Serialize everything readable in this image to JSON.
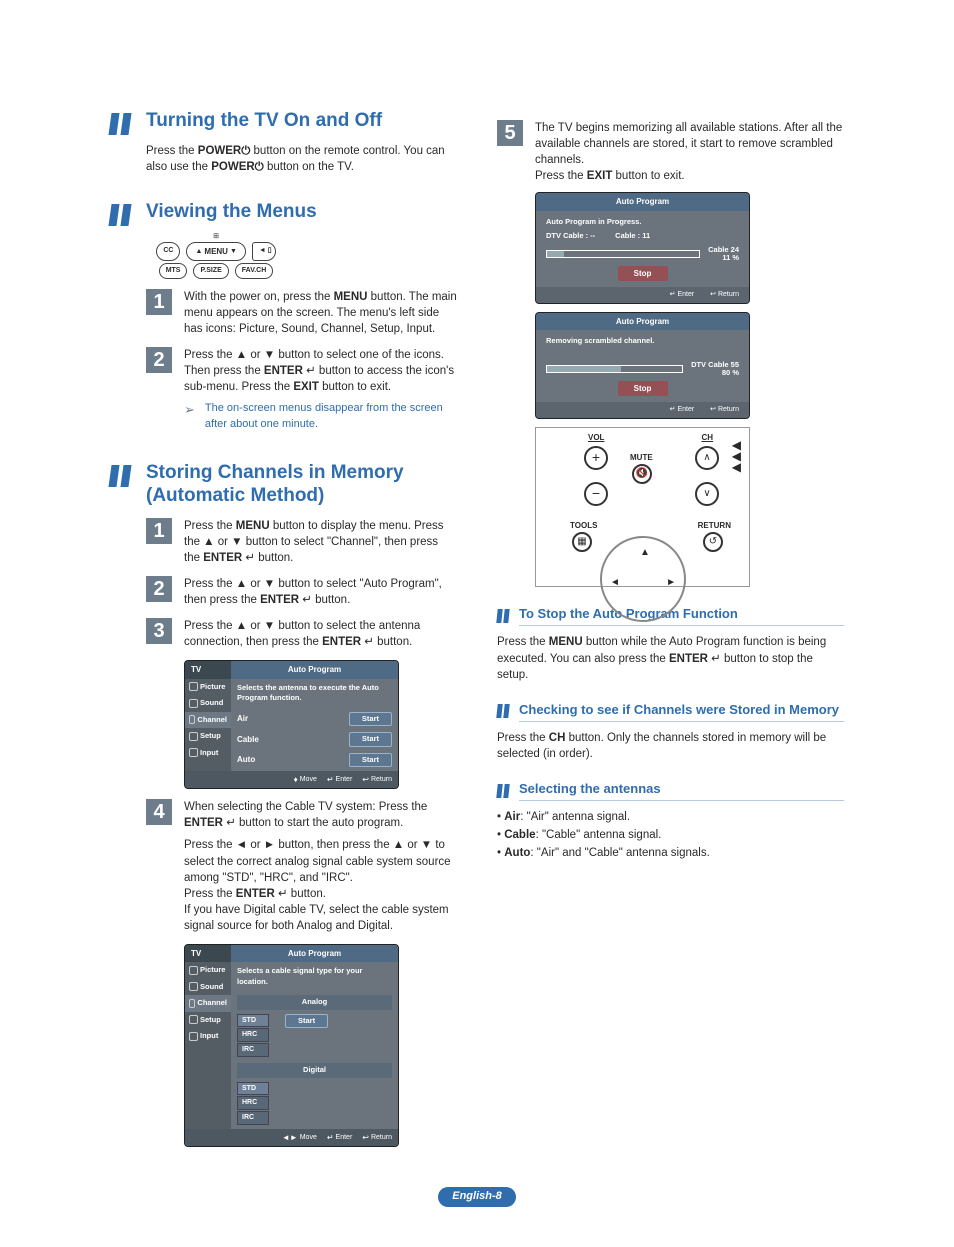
{
  "left": {
    "sec1": {
      "title": "Turning the TV On and Off",
      "p1_a": "Press the ",
      "p1_power": "POWER",
      "p1_b": " button on the remote control. You can also use the ",
      "p1_c": " button on the TV."
    },
    "sec2": {
      "title": "Viewing the Menus",
      "nav": {
        "cc": "CC",
        "menu": "MENU",
        "mts": "MTS",
        "psize": "P.SIZE",
        "favch": "FAV.CH"
      },
      "step1": {
        "num": "1",
        "a": "With the power on, press the ",
        "menu": "MENU",
        "b": " button. The main menu appears on the screen. The menu's left side has icons: Picture, Sound, Channel, Setup, Input."
      },
      "step2": {
        "num": "2",
        "a": "Press the ▲ or ▼ button to select one of the icons. Then press the ",
        "enter": "ENTER",
        "b": " button to access the icon's sub-menu. Press the ",
        "exit": "EXIT",
        "c": " button to exit."
      },
      "note": "The on-screen menus disappear from the screen after about one minute."
    },
    "sec3": {
      "title": "Storing Channels in Memory (Automatic Method)",
      "step1": {
        "num": "1",
        "a": "Press the ",
        "menu": "MENU",
        "b": " button to display the menu. Press the ▲ or ▼ button to select \"Channel\", then press the ",
        "enter": "ENTER",
        "c": " button."
      },
      "step2": {
        "num": "2",
        "a": "Press the ▲ or ▼ button to select \"Auto Program\", then press the ",
        "enter": "ENTER",
        "b": " button."
      },
      "step3": {
        "num": "3",
        "a": "Press the ▲ or ▼ button to select the antenna connection, then press the ",
        "enter": "ENTER",
        "b": " button."
      },
      "ui1": {
        "tv": "TV",
        "title": "Auto Program",
        "msg": "Selects the antenna to execute the Auto Program function.",
        "opts": [
          "Air",
          "Cable",
          "Auto"
        ],
        "start": "Start",
        "menu": [
          "Picture",
          "Sound",
          "Channel",
          "Setup",
          "Input"
        ],
        "footer": {
          "move": "Move",
          "enter": "Enter",
          "return": "Return"
        }
      },
      "step4": {
        "num": "4",
        "a": "When selecting the Cable TV system: Press the ",
        "enter": "ENTER",
        "b": " button to start the auto program.",
        "p2a": "Press the ◄ or ► button, then press the ▲ or ▼ to select the correct analog signal cable system source among \"STD\", \"HRC\", and \"IRC\".",
        "p2b": "Press the ",
        "p2c": " button.",
        "p2d": "If you have Digital cable TV, select the cable system signal source for both Analog and Digital."
      },
      "ui2": {
        "tv": "TV",
        "title": "Auto Program",
        "msg": "Selects a cable signal type for your location.",
        "analog_label": "Analog",
        "digital_label": "Digital",
        "sigs": [
          "STD",
          "HRC",
          "IRC"
        ],
        "start": "Start",
        "menu": [
          "Picture",
          "Sound",
          "Channel",
          "Setup",
          "Input"
        ],
        "footer": {
          "move": "Move",
          "enter": "Enter",
          "return": "Return"
        }
      }
    }
  },
  "right": {
    "step5": {
      "num": "5",
      "a": "The TV begins memorizing all available stations. After all the available channels are stored, it start to remove scrambled channels.",
      "b": "Press the ",
      "exit": "EXIT",
      "c": " button to exit."
    },
    "prog1": {
      "title": "Auto Program",
      "status": "Auto Program in Progress.",
      "dtv": "DTV Cable : --",
      "cbl": "Cable : 11",
      "pbar_label_a": "Cable  24",
      "pbar_label_b": "11   %",
      "stop": "Stop",
      "enter": "Enter",
      "return": "Return"
    },
    "prog2": {
      "title": "Auto Program",
      "status": "Removing scrambled channel.",
      "pbar_label_a": "DTV Cable 55",
      "pbar_label_b": "80   %",
      "stop": "Stop",
      "enter": "Enter",
      "return": "Return"
    },
    "remote": {
      "vol": "VOL",
      "ch": "CH",
      "mute": "MUTE",
      "tools": "TOOLS",
      "return": "RETURN"
    },
    "sub1": {
      "title": "To Stop the Auto Program Function",
      "a": "Press the ",
      "menu": "MENU",
      "b": " button while the Auto Program function is being executed. You can also press the ",
      "enter": "ENTER",
      "c": " button to stop the setup."
    },
    "sub2": {
      "title": "Checking to see if Channels were Stored in Memory",
      "a": "Press the ",
      "ch": "CH",
      "b": " button. Only the channels stored in memory will be selected (in order)."
    },
    "sub3": {
      "title": "Selecting the antennas",
      "items": [
        {
          "label": "Air",
          "desc": ": \"Air\" antenna signal."
        },
        {
          "label": "Cable",
          "desc": ": \"Cable\" antenna signal."
        },
        {
          "label": "Auto",
          "desc": ": \"Air\" and \"Cable\" antenna signals."
        }
      ]
    }
  },
  "footer": "English-8",
  "glyphs": {
    "power": "⏻",
    "enter_icon": "↵"
  }
}
